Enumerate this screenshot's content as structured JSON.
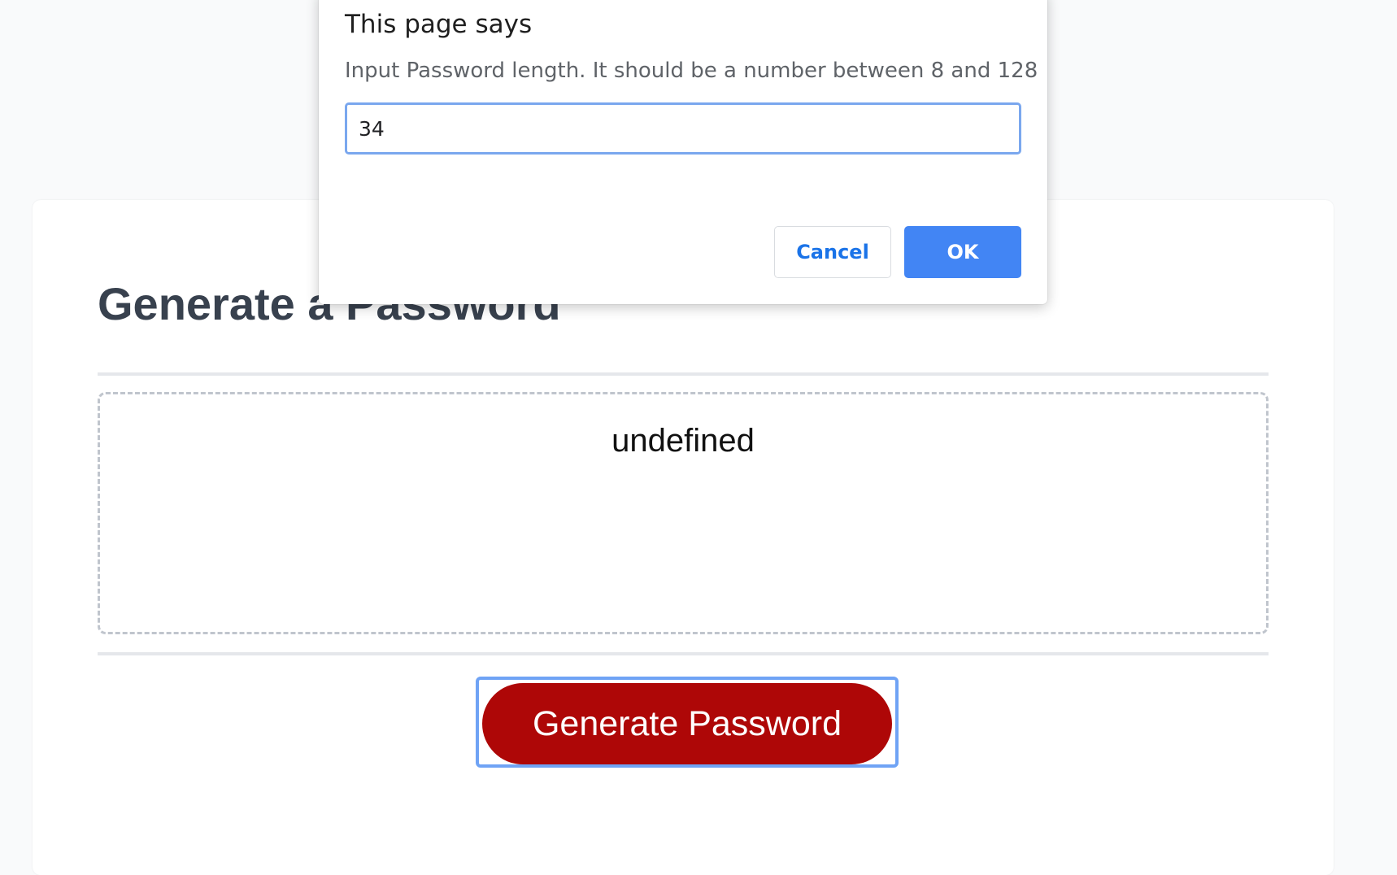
{
  "page": {
    "title": "Generate a Password",
    "password_output": "undefined",
    "generate_button_label": "Generate Password"
  },
  "dialog": {
    "title": "This page says",
    "message": "Input Password length. It should be a number between 8 and 128",
    "input_value": "34",
    "cancel_label": "Cancel",
    "ok_label": "OK"
  },
  "colors": {
    "background": "#f9fafb",
    "card": "#ffffff",
    "title_text": "#38414e",
    "generate_button": "#ae0707",
    "focus_ring": "#6fa3f5",
    "ok_button": "#4285f4",
    "cancel_text": "#1a73e8"
  }
}
